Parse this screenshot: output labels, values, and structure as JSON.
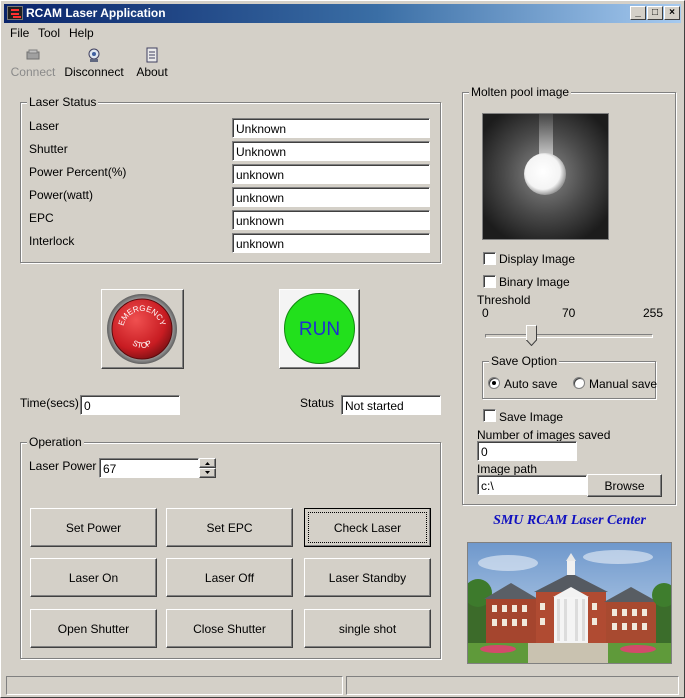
{
  "window": {
    "title": "RCAM Laser Application"
  },
  "menu": [
    "File",
    "Tool",
    "Help"
  ],
  "toolbar": {
    "connect": "Connect",
    "disconnect": "Disconnect",
    "about": "About"
  },
  "laser_status": {
    "title": "Laser Status",
    "rows": [
      {
        "label": "Laser",
        "value": "Unknown"
      },
      {
        "label": "Shutter",
        "value": "Unknown"
      },
      {
        "label": "Power Percent(%)",
        "value": "unknown"
      },
      {
        "label": "Power(watt)",
        "value": "unknown"
      },
      {
        "label": "EPC",
        "value": "unknown"
      },
      {
        "label": "Interlock",
        "value": "unknown"
      }
    ]
  },
  "emergency": {
    "top_text": "EMERGENCY",
    "bottom_text": "STOP",
    "color": "#d8262c"
  },
  "run": {
    "label": "RUN",
    "color": "#22e01c",
    "text_color": "#1e2fd0"
  },
  "time": {
    "label": "Time(secs)",
    "value": "0"
  },
  "status": {
    "label": "Status",
    "value": "Not started"
  },
  "operation": {
    "title": "Operation",
    "laser_power_label": "Laser Power",
    "laser_power_value": "67",
    "buttons": [
      "Set Power",
      "Set EPC",
      "Check Laser",
      "Laser On",
      "Laser Off",
      "Laser Standby",
      "Open Shutter",
      "Close Shutter",
      "single shot"
    ]
  },
  "molten_pool": {
    "title": "Molten pool image",
    "display_image": "Display Image",
    "binary_image": "Binary Image",
    "threshold": {
      "label": "Threshold",
      "min": "0",
      "mid": "70",
      "max": "255",
      "value": 70,
      "max_value": 255
    },
    "save_option": {
      "title": "Save Option",
      "auto": "Auto save",
      "manual": "Manual save",
      "selected": "auto"
    },
    "save_image": "Save Image",
    "images_saved_label": "Number of images saved",
    "images_saved_value": "0",
    "image_path_label": "Image path",
    "image_path_value": "c:\\",
    "browse": "Browse"
  },
  "brand": {
    "text": "SMU RCAM Laser Center",
    "color": "#1010c0"
  }
}
